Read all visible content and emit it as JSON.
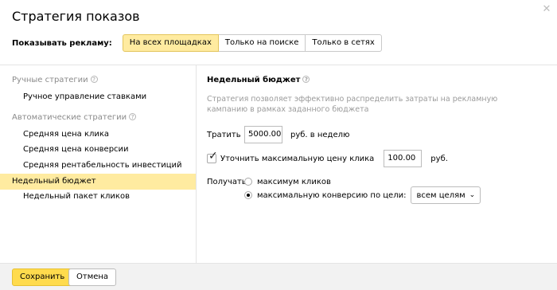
{
  "dialog": {
    "title": "Стратегия показов",
    "close_icon": "close-icon"
  },
  "show_ads": {
    "label": "Показывать рекламу:",
    "options": [
      "На всех площадках",
      "Только на поиске",
      "Только в сетях"
    ],
    "selected": "На всех площадках"
  },
  "manual": {
    "header": "Ручные стратегии",
    "items": [
      "Ручное управление ставками"
    ]
  },
  "auto": {
    "header": "Автоматические стратегии",
    "items": [
      "Средняя цена клика",
      "Средняя цена конверсии",
      "Средняя рентабельность инвестиций",
      "Недельный бюджет",
      "Недельный пакет кликов"
    ],
    "selected": "Недельный бюджет"
  },
  "help_icon": "?",
  "settings": {
    "heading": "Недельный бюджет",
    "description": "Стратегия позволяет эффективно распределить затраты на рекламную кампанию в рамках заданного бюджета",
    "spend_label": "Тратить",
    "spend_value": "5000.00",
    "spend_unit": "руб. в неделю",
    "refine_label": "Уточнить максимальную цену клика",
    "refine_checked": true,
    "refine_value": "100.00",
    "refine_unit": "руб.",
    "get_label": "Получать:",
    "option_clicks": "максимум кликов",
    "option_conversion": "максимальную конверсию по цели:",
    "selected_option": "максимальную конверсию по цели:",
    "goal_select": "всем целям"
  },
  "footer": {
    "save": "Сохранить",
    "cancel": "Отмена"
  },
  "colors": {
    "accent_yellow": "#ffeba0",
    "button_yellow": "#ffdb4d"
  }
}
